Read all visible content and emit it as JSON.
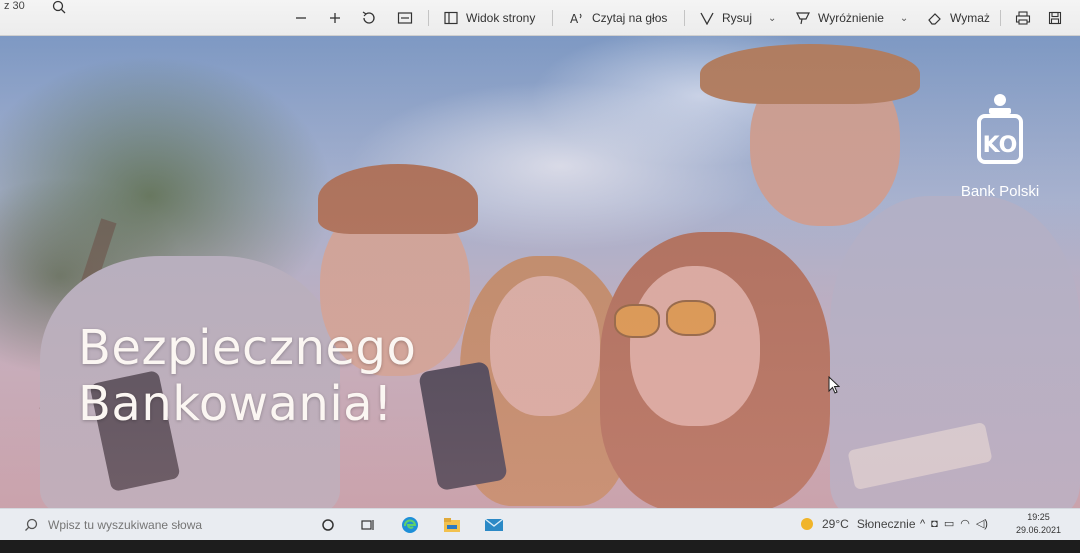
{
  "toolbar": {
    "page_suffix": "z 30",
    "page_view_label": "Widok strony",
    "read_aloud_label": "Czytaj na głos",
    "draw_label": "Rysuj",
    "highlight_label": "Wyróżnienie",
    "erase_label": "Wymaż",
    "icons": [
      "search-icon",
      "zoom-out-icon",
      "zoom-in-icon",
      "rotate-icon",
      "fit-page-icon",
      "page-view-icon",
      "read-aloud-icon",
      "draw-icon",
      "highlight-icon",
      "eraser-icon",
      "print-icon",
      "save-icon"
    ]
  },
  "slide": {
    "headline_line1": "Bezpiecznego",
    "headline_line2": "Bankowania!",
    "brand": "Bank Polski",
    "brand_color": "#ffffff"
  },
  "taskbar": {
    "search_placeholder": "Wpisz tu wyszukiwane słowa",
    "weather_temp": "29°C",
    "weather_desc": "Słonecznie",
    "time": "19:25",
    "date": "29.06.2021",
    "apps": [
      "task-view-icon",
      "edge-icon",
      "file-explorer-icon",
      "mail-icon"
    ]
  },
  "colors": {
    "toolbar_bg": "#f0f0f0",
    "taskbar_bg": "#e9ecf1",
    "headline": "#fbf6f2"
  }
}
